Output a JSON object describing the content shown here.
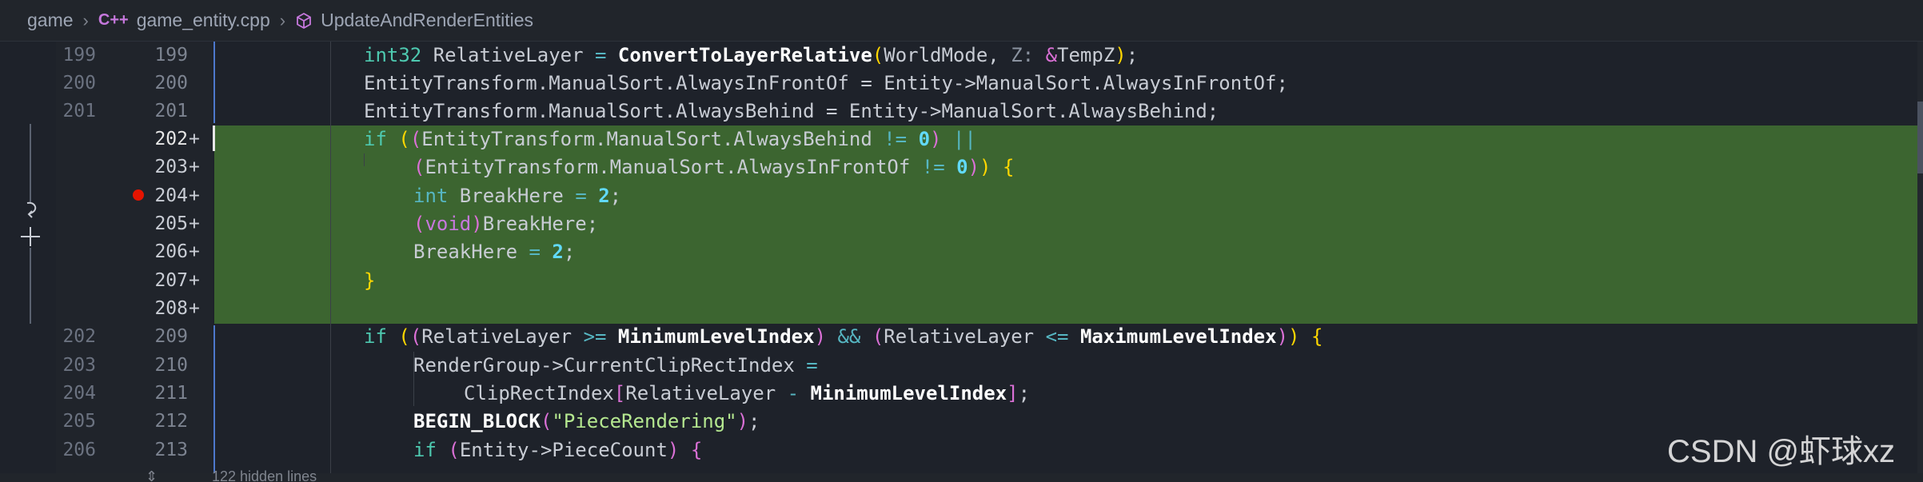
{
  "breadcrumb": {
    "items": [
      "game",
      "game_entity.cpp",
      "UpdateAndRenderEntities"
    ],
    "file_badge": "C++"
  },
  "left_gutter": {
    "revert_icon": "revert-icon",
    "stage_icon": "plus-icon"
  },
  "rows": [
    {
      "old": "199",
      "new": "199",
      "plus": ""
    },
    {
      "old": "200",
      "new": "200",
      "plus": ""
    },
    {
      "old": "201",
      "new": "201",
      "plus": ""
    },
    {
      "old": "",
      "new": "202",
      "plus": "+"
    },
    {
      "old": "",
      "new": "203",
      "plus": "+"
    },
    {
      "old": "",
      "new": "204",
      "plus": "+"
    },
    {
      "old": "",
      "new": "205",
      "plus": "+"
    },
    {
      "old": "",
      "new": "206",
      "plus": "+"
    },
    {
      "old": "",
      "new": "207",
      "plus": "+"
    },
    {
      "old": "",
      "new": "208",
      "plus": "+"
    },
    {
      "old": "202",
      "new": "209",
      "plus": ""
    },
    {
      "old": "203",
      "new": "210",
      "plus": ""
    },
    {
      "old": "204",
      "new": "211",
      "plus": ""
    },
    {
      "old": "205",
      "new": "212",
      "plus": ""
    },
    {
      "old": "206",
      "new": "213",
      "plus": ""
    }
  ],
  "code": {
    "l199": [
      "int32",
      " RelativeLayer ",
      "=",
      " ",
      "ConvertToLayerRelative",
      "(",
      "WorldMode, ",
      "Z:",
      " ",
      "&",
      "TempZ",
      ")",
      ";"
    ],
    "l200": "EntityTransform.ManualSort.AlwaysInFrontOf = Entity->ManualSort.AlwaysInFrontOf;",
    "l201": "EntityTransform.ManualSort.AlwaysBehind = Entity->ManualSort.AlwaysBehind;",
    "l202": [
      "if",
      " ",
      "(",
      "(",
      "EntityTransform.ManualSort.AlwaysBehind ",
      "!=",
      " ",
      "0",
      ")",
      " ",
      "||"
    ],
    "l203": [
      "(",
      "EntityTransform.ManualSort.AlwaysInFrontOf ",
      "!=",
      " ",
      "0",
      ")",
      ")",
      " ",
      "{"
    ],
    "l204": [
      "int",
      " BreakHere ",
      "=",
      " ",
      "2",
      ";"
    ],
    "l205": [
      "(",
      "void",
      ")",
      "BreakHere;"
    ],
    "l206": [
      "BreakHere ",
      "=",
      " ",
      "2",
      ";"
    ],
    "l207": [
      "}"
    ],
    "l209": [
      "if",
      " ",
      "(",
      "(",
      "RelativeLayer ",
      ">=",
      " ",
      "MinimumLevelIndex",
      ")",
      " ",
      "&&",
      " ",
      "(",
      "RelativeLayer ",
      "<=",
      " ",
      "MaximumLevelIndex",
      ")",
      ")",
      " ",
      "{"
    ],
    "l210": [
      "RenderGroup->CurrentClipRectIndex ",
      "="
    ],
    "l211": [
      "ClipRectIndex",
      "[",
      "RelativeLayer ",
      "-",
      " ",
      "MinimumLevelIndex",
      "]",
      ";"
    ],
    "l212": [
      "BEGIN_BLOCK",
      "(",
      "\"PieceRendering\"",
      ")",
      ";"
    ],
    "l213": [
      "if",
      " ",
      "(",
      "Entity->PieceCount",
      ")",
      " ",
      "{"
    ]
  },
  "footer": {
    "hidden_lines": "122 hidden lines"
  },
  "watermark": "CSDN @虾球xz",
  "colors": {
    "added_line_bg": "#3c6530",
    "breakpoint": "#e51400",
    "keyword": "#4ec9b0"
  }
}
